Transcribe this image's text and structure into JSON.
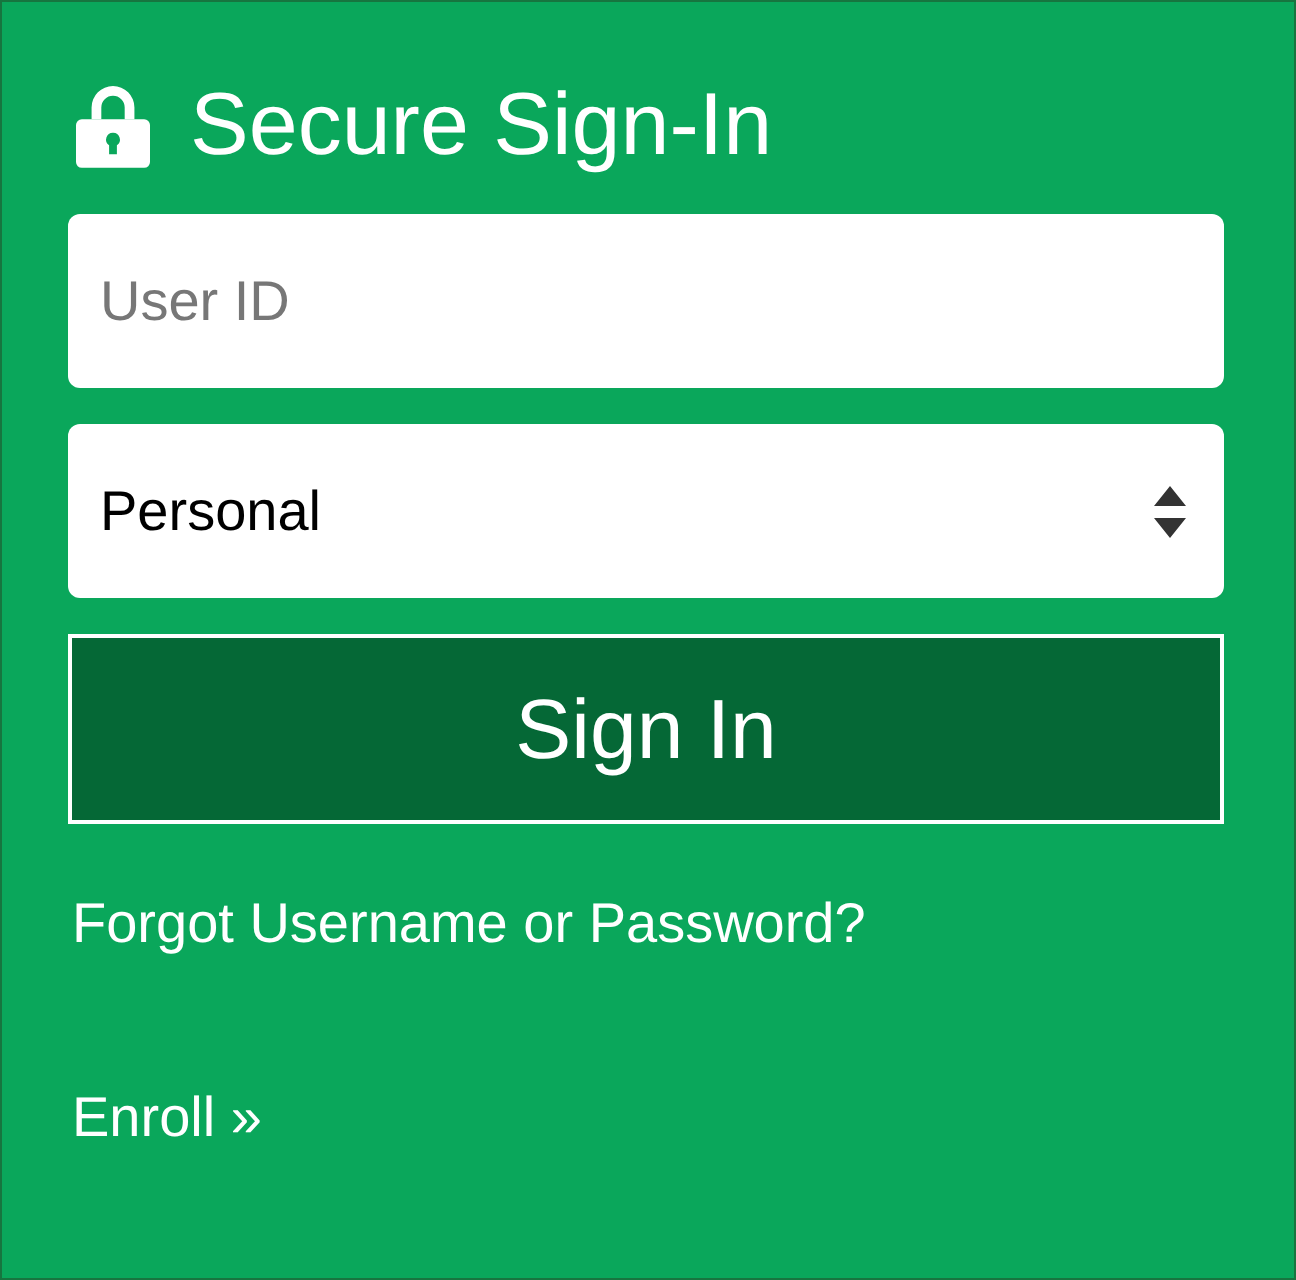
{
  "title": "Secure Sign-In",
  "user_id": {
    "placeholder": "User ID"
  },
  "account_type": {
    "value": "Personal"
  },
  "sign_in_button": "Sign In",
  "links": [
    "Forgot Username or Password?",
    "Enroll »"
  ]
}
